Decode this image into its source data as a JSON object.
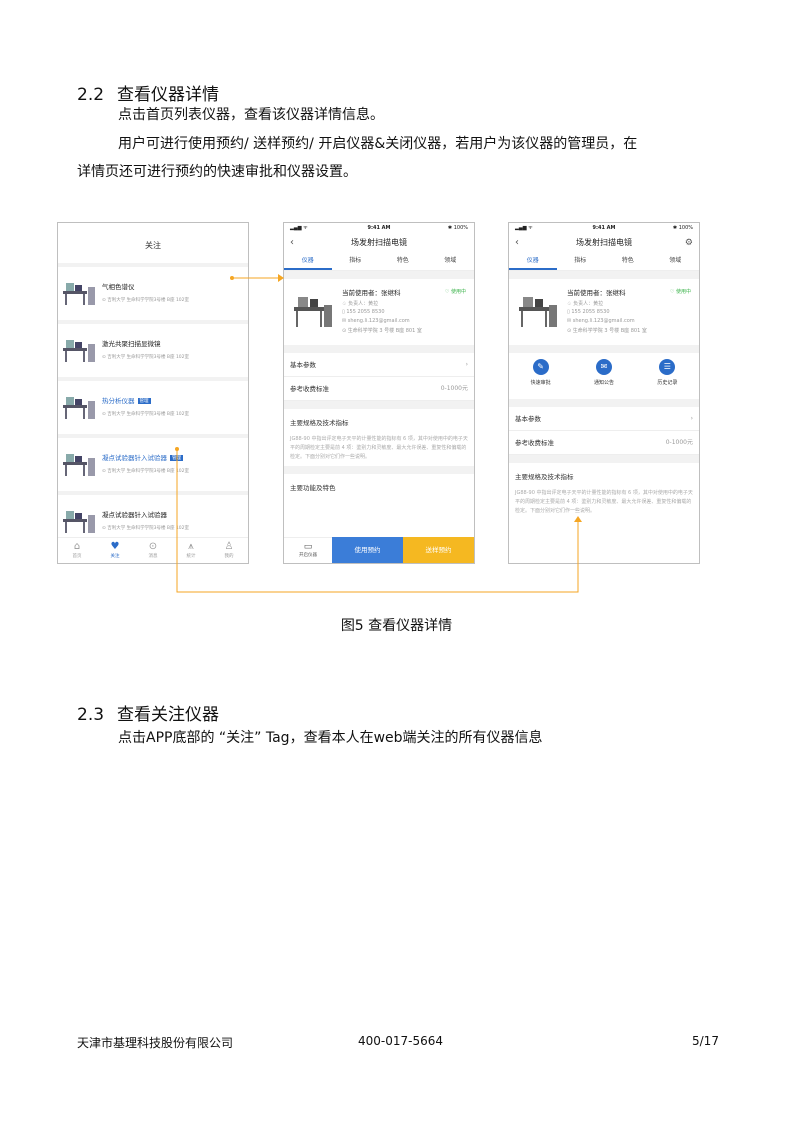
{
  "section_2_2": {
    "number": "2.2",
    "title": "查看仪器详情",
    "para1": "点击首页列表仪器，查看该仪器详情信息。",
    "para2_line1": "用户可进行使用预约/ 送样预约/  开启仪器&关闭仪器，若用户为该仪器的管理员，在",
    "para2_line2": "详情页还可进行预约的快速审批和仪器设置。"
  },
  "figure": {
    "caption": "图5  查看仪器详情",
    "list_phone": {
      "title": "关注",
      "items": [
        {
          "name": "气相色谱仪",
          "tag": "",
          "location": "⊙ 吉利大学 生命科学学院3号楼 B座 102室"
        },
        {
          "name": "激光共聚扫描显微镜",
          "tag": "",
          "location": "⊙ 吉利大学 生命科学学院3号楼 B座 102室"
        },
        {
          "name": "热分析仪器",
          "tag": "管理",
          "location": "⊙ 吉利大学 生命科学学院3号楼 B座 102室"
        },
        {
          "name": "凝点试验器针入试验器",
          "tag": "管理",
          "location": "⊙ 吉利大学 生命科学学院3号楼 B座 102室"
        },
        {
          "name": "凝点试验器针入试验器",
          "tag": "",
          "location": "⊙ 吉利大学 生命科学学院3号楼 B座 102室"
        }
      ],
      "tabbar": [
        "首页",
        "关注",
        "消息",
        "统计",
        "我的"
      ]
    },
    "detail_phone": {
      "status_time": "9:41 AM",
      "status_battery": "✱ 100%",
      "status_signal": "▂▄▆ ᯤ",
      "title": "场发射扫描电镜",
      "tabs": [
        "仪器",
        "指标",
        "特色",
        "领域"
      ],
      "current_user": "当前使用者：张继科",
      "status_ok": "♡ 使用中",
      "owner": "♤ 负责人：黄拉",
      "phone": "▯ 155 2055 8530",
      "email": "✉ sheng.li.123@gmail.com",
      "address": "⊙ 生命科学学院 3 号楼 B座 801 室",
      "basic_params": "基本参数",
      "fee_label": "参考收费标准",
      "fee_value": "0-1000元",
      "spec_title": "主要规格及技术指标",
      "spec_text": "JG88-90 中指出评定电子天平的计量性能的指标有 6 项，其中对使用中的电子天平的周期检定主要是前 4 项：鉴别力和灵敏度、最大允许误差、重复性和偏载的检定。下面分别对它们作一些说明。",
      "func_title": "主要功能及特色",
      "btn_open": "开启仪器",
      "btn_use": "使用预约",
      "btn_sample": "送样预约"
    },
    "admin_phone": {
      "quick_actions": [
        "快速审批",
        "通知公告",
        "历史记录"
      ]
    }
  },
  "section_2_3": {
    "number": "2.3",
    "title": "查看关注仪器",
    "para": "点击APP底部的 “关注” Tag，查看本人在web端关注的所有仪器信息"
  },
  "footer": {
    "company": "天津市基理科技股份有限公司",
    "phone": "400-017-5664",
    "page": "5/17"
  },
  "colors": {
    "accent_blue": "#2b6cc8",
    "accent_orange": "#f5a623",
    "ok_green": "#3bb34a"
  }
}
